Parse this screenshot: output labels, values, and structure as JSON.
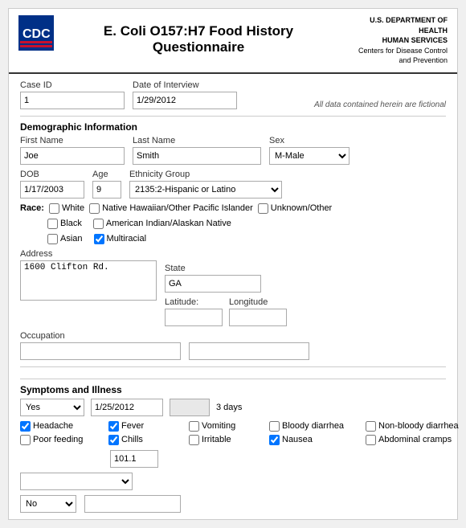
{
  "header": {
    "title": "E. Coli O157:H7 Food History Questionnaire",
    "dept_line1": "U.S. DEPARTMENT OF HEALTH",
    "dept_line2": "HUMAN SERVICES",
    "dept_line3": "Centers for Disease Control",
    "dept_line4": "and Prevention"
  },
  "case": {
    "id_label": "Case ID",
    "id_value": "1",
    "date_label": "Date of Interview",
    "date_value": "1/29/2012",
    "fictional_note": "All data contained herein are fictional"
  },
  "demographic": {
    "section_label": "Demographic Information",
    "first_name_label": "First Name",
    "first_name_value": "Joe",
    "last_name_label": "Last Name",
    "last_name_value": "Smith",
    "sex_label": "Sex",
    "sex_value": "M-Male",
    "dob_label": "DOB",
    "dob_value": "1/17/2003",
    "age_label": "Age",
    "age_value": "9",
    "ethnicity_label": "Ethnicity Group",
    "ethnicity_value": "2135:2-Hispanic or Latino",
    "race_label": "Race:",
    "race_options": [
      {
        "label": "White",
        "checked": false
      },
      {
        "label": "Native Hawaiian/Other Pacific Islander",
        "checked": false
      },
      {
        "label": "Unknown/Other",
        "checked": false
      },
      {
        "label": "Black",
        "checked": false
      },
      {
        "label": "American Indian/Alaskan Native",
        "checked": false
      },
      {
        "label": "Asian",
        "checked": false
      },
      {
        "label": "Multiracial",
        "checked": true
      }
    ],
    "address_label": "Address",
    "address_value": "1600 Clifton Rd.",
    "state_label": "State",
    "state_value": "GA",
    "latitude_label": "Latitude:",
    "longitude_label": "Longitude",
    "occupation_label": "Occupation"
  },
  "symptoms": {
    "section_label": "Symptoms and Illness",
    "ill_value": "Yes",
    "date_value": "1/25/2012",
    "duration": "3 days",
    "checkboxes": [
      {
        "label": "Headache",
        "checked": true
      },
      {
        "label": "Fever",
        "checked": true
      },
      {
        "label": "Vomiting",
        "checked": false
      },
      {
        "label": "Bloody diarrhea",
        "checked": false
      },
      {
        "label": "Non-bloody diarrhea",
        "checked": false
      },
      {
        "label": "Poor feeding",
        "checked": false
      },
      {
        "label": "Chills",
        "checked": true
      },
      {
        "label": "Irritable",
        "checked": false
      },
      {
        "label": "Nausea",
        "checked": true
      },
      {
        "label": "Abdominal cramps",
        "checked": false
      }
    ],
    "temp_value": "101.1",
    "no_value": "No"
  }
}
